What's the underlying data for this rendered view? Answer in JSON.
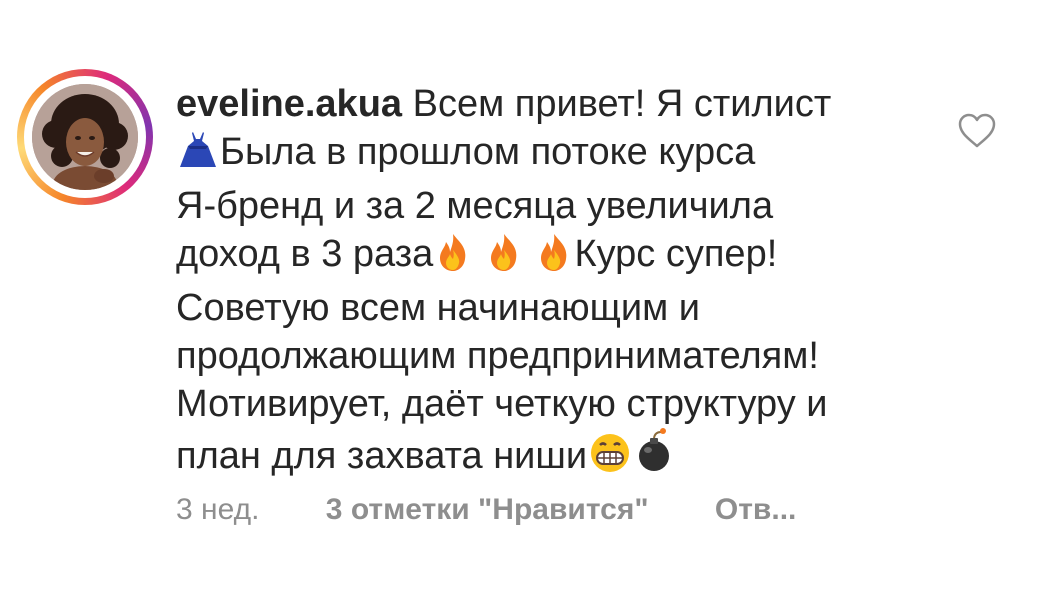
{
  "comment": {
    "username": "eveline.akua",
    "text": {
      "part1": " Всем привет! Я стилист\n",
      "part2": "Была в прошлом потоке курса\nЯ-бренд и за 2 месяца увеличила\nдоход в 3 раза",
      "part3": "Курс супер!\nСоветую всем начинающим и\nпродолжающим предпринимателям!\nМотивирует, даёт четкую структуру и\nплан для захвата ниши"
    },
    "icons": [
      "dress-emoji",
      "fire-emoji",
      "fire-emoji",
      "fire-emoji",
      "grin-emoji",
      "bomb-emoji",
      "heart-outline-icon"
    ],
    "time": "3 нед.",
    "likes_label": "3 отметки \"Нравится\"",
    "reply_label": "Отв..."
  },
  "colors": {
    "text": "#262626",
    "muted": "#8e8e8e",
    "ring_start": "#f58529",
    "ring_end": "#dd2a7b"
  }
}
